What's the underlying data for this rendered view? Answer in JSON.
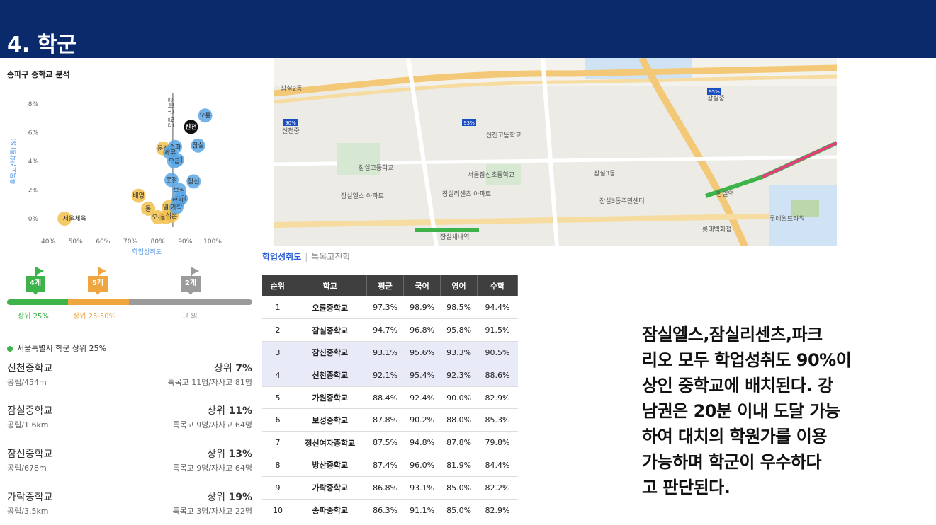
{
  "header": {
    "title": "4. 학군"
  },
  "chart_data": {
    "type": "scatter",
    "title": "송파구 중학교 분석",
    "xlabel": "학업성취도",
    "ylabel": "특목고진학률(%)",
    "x_ticks": [
      "40%",
      "50%",
      "60%",
      "70%",
      "80%",
      "90%",
      "100%"
    ],
    "y_ticks": [
      "0%",
      "2%",
      "4%",
      "6%",
      "8%"
    ],
    "xlim": [
      40,
      100
    ],
    "ylim": [
      0,
      8
    ],
    "avg_label": "송파구 평균",
    "avg_x": 85.5,
    "points": [
      {
        "label": "오륜",
        "x": 97.3,
        "y": 7.2,
        "color": "#5aa8e6"
      },
      {
        "label": "신천",
        "x": 92.1,
        "y": 6.4,
        "color": "#111111"
      },
      {
        "label": "잠실",
        "x": 94.7,
        "y": 5.1,
        "color": "#5aa8e6"
      },
      {
        "label": "문정",
        "x": 82.0,
        "y": 4.9,
        "color": "#f2c14e"
      },
      {
        "label": "송파",
        "x": 86.3,
        "y": 5.0,
        "color": "#5aa8e6"
      },
      {
        "label": "송례",
        "x": 87.0,
        "y": 4.1,
        "color": "#5aa8e6"
      },
      {
        "label": "세륜",
        "x": 84.5,
        "y": 4.6,
        "color": "#5aa8e6"
      },
      {
        "label": "오금",
        "x": 86.0,
        "y": 4.0,
        "color": "#5aa8e6"
      },
      {
        "label": "잠신",
        "x": 93.1,
        "y": 2.6,
        "color": "#5aa8e6"
      },
      {
        "label": "문정",
        "x": 85.0,
        "y": 2.7,
        "color": "#5aa8e6"
      },
      {
        "label": "보성",
        "x": 87.8,
        "y": 2.0,
        "color": "#5aa8e6"
      },
      {
        "label": "배명",
        "x": 73.0,
        "y": 1.6,
        "color": "#f2c14e"
      },
      {
        "label": "가원",
        "x": 88.4,
        "y": 1.4,
        "color": "#5aa8e6"
      },
      {
        "label": "방산",
        "x": 87.4,
        "y": 1.2,
        "color": "#5aa8e6"
      },
      {
        "label": "동",
        "x": 76.5,
        "y": 0.7,
        "color": "#f2c14e"
      },
      {
        "label": "일신",
        "x": 84.0,
        "y": 0.8,
        "color": "#f2c14e"
      },
      {
        "label": "오륜",
        "x": 80.0,
        "y": 0.1,
        "color": "#f2c14e"
      },
      {
        "label": "풍납",
        "x": 83.0,
        "y": 0.1,
        "color": "#f2c14e"
      },
      {
        "label": "석촌",
        "x": 85.0,
        "y": 0.2,
        "color": "#f2c14e"
      },
      {
        "label": "가락",
        "x": 86.8,
        "y": 0.8,
        "color": "#5aa8e6"
      },
      {
        "label": "서울체육",
        "x": 46.0,
        "y": 0.0,
        "color": "#f2c14e"
      }
    ]
  },
  "tiers": {
    "top": {
      "count": "4개",
      "label": "상위 25%",
      "color": "#3db34a"
    },
    "mid": {
      "count": "5개",
      "label": "상위 25-50%",
      "color": "#f0a640"
    },
    "rest": {
      "count": "2개",
      "label": "그 외",
      "color": "#9b9b9b"
    }
  },
  "legend": {
    "label": "서울특별시 학군 상위 25%"
  },
  "schools": [
    {
      "name": "신천중학교",
      "rank_prefix": "상위 ",
      "rank": "7%",
      "sub": "공립/454m",
      "spec": "특목고 11명/자사고 81명"
    },
    {
      "name": "잠실중학교",
      "rank_prefix": "상위 ",
      "rank": "11%",
      "sub": "공립/1.6km",
      "spec": "특목고 9명/자사고 64명"
    },
    {
      "name": "잠신중학교",
      "rank_prefix": "상위 ",
      "rank": "13%",
      "sub": "공립/678m",
      "spec": "특목고 9명/자사고 64명"
    },
    {
      "name": "가락중학교",
      "rank_prefix": "상위 ",
      "rank": "19%",
      "sub": "공립/3.5km",
      "spec": "특목고 3명/자사고 22명"
    }
  ],
  "map": {
    "labels": [
      "잠실2동",
      "잠실3동",
      "잠실역",
      "잠실새내역",
      "롯데월드타워",
      "신천중",
      "신천고등학교",
      "잠실고등학교",
      "서울잠신초등학교",
      "잠실엘스 아파트",
      "잠실리센츠 아파트",
      "잠실3동주민센터",
      "롯데백화점",
      "잠실중"
    ],
    "pins": [
      "90%",
      "93%",
      "95%"
    ]
  },
  "tabs": {
    "active": "학업성취도",
    "inactive": "특목고진학"
  },
  "table": {
    "headers": [
      "순위",
      "학교",
      "평균",
      "국어",
      "영어",
      "수학"
    ],
    "rows": [
      [
        "1",
        "오륜중학교",
        "97.3%",
        "98.9%",
        "98.5%",
        "94.4%"
      ],
      [
        "2",
        "잠실중학교",
        "94.7%",
        "96.8%",
        "95.8%",
        "91.5%"
      ],
      [
        "3",
        "잠신중학교",
        "93.1%",
        "95.6%",
        "93.3%",
        "90.5%"
      ],
      [
        "4",
        "신천중학교",
        "92.1%",
        "95.4%",
        "92.3%",
        "88.6%"
      ],
      [
        "5",
        "가원중학교",
        "88.4%",
        "92.4%",
        "90.0%",
        "82.9%"
      ],
      [
        "6",
        "보성중학교",
        "87.8%",
        "90.2%",
        "88.0%",
        "85.3%"
      ],
      [
        "7",
        "정신여자중학교",
        "87.5%",
        "94.8%",
        "87.8%",
        "79.8%"
      ],
      [
        "8",
        "방산중학교",
        "87.4%",
        "96.0%",
        "81.9%",
        "84.4%"
      ],
      [
        "9",
        "가락중학교",
        "86.8%",
        "93.1%",
        "85.0%",
        "82.2%"
      ],
      [
        "10",
        "송파중학교",
        "86.3%",
        "91.1%",
        "85.0%",
        "82.9%"
      ]
    ]
  },
  "comment": {
    "lines": [
      "잠실엘스,잠실리센츠,파크",
      "리오 모두 학업성취도 90%이",
      "상인 중학교에 배치된다. 강",
      "남권은 20분 이내 도달 가능",
      "하여 대치의 학원가를 이용",
      "가능하며 학군이 우수하다",
      "고 판단된다."
    ]
  }
}
